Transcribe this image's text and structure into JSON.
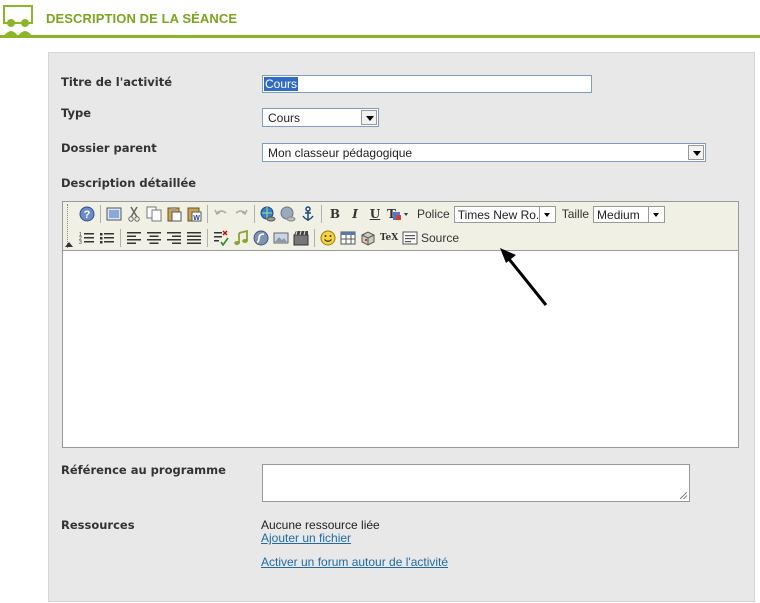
{
  "header": {
    "title": "DESCRIPTION DE LA SÉANCE",
    "icon": "group-icon"
  },
  "form": {
    "titre_label": "Titre de l'activité",
    "titre_value": "Cours",
    "type_label": "Type",
    "type_value": "Cours",
    "dossier_label": "Dossier parent",
    "dossier_value": "Mon classeur pédagogique",
    "description_label": "Description détaillée",
    "reference_label": "Référence au programme",
    "ressources_label": "Ressources",
    "ressources_status": "Aucune ressource liée",
    "ajouter_fichier": "Ajouter un fichier",
    "activer_forum": "Activer un forum autour de l'activité"
  },
  "editor": {
    "police_label": "Police",
    "police_value": "Times New Ro...",
    "taille_label": "Taille",
    "taille_value": "Medium",
    "source_label": "Source",
    "tex_label": "TeX"
  },
  "colors": {
    "accent": "#8cb62a",
    "title": "#7aa51e",
    "link": "#1f6aa5",
    "panel": "#e8e8e8",
    "toolbar": "#f0f0e4"
  }
}
